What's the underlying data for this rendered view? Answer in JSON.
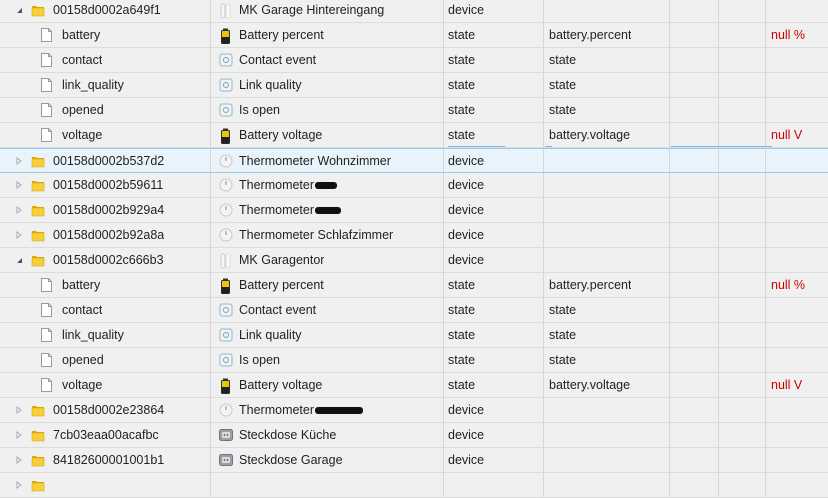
{
  "rows": [
    {
      "kind": "device",
      "expanded": true,
      "id": "00158d0002a649f1",
      "icon": "door-sensor-icon",
      "label": "MK Garage Hintereingang",
      "type": "device",
      "role": "",
      "unit": ""
    },
    {
      "kind": "state",
      "id": "battery",
      "icon": "battery-icon",
      "label": "Battery percent",
      "type": "state",
      "role": "battery.percent",
      "unit": "null %"
    },
    {
      "kind": "state",
      "id": "contact",
      "icon": "state-icon",
      "label": "Contact event",
      "type": "state",
      "role": "state",
      "unit": ""
    },
    {
      "kind": "state",
      "id": "link_quality",
      "icon": "state-icon",
      "label": "Link quality",
      "type": "state",
      "role": "state",
      "unit": ""
    },
    {
      "kind": "state",
      "id": "opened",
      "icon": "state-icon",
      "label": "Is open",
      "type": "state",
      "role": "state",
      "unit": ""
    },
    {
      "kind": "state",
      "id": "voltage",
      "icon": "battery-icon",
      "label": "Battery voltage",
      "type": "state",
      "role": "battery.voltage",
      "unit": "null V"
    },
    {
      "kind": "device",
      "expanded": false,
      "selected": true,
      "id": "00158d0002b537d2",
      "icon": "thermometer-icon",
      "label": "Thermometer Wohnzimmer",
      "type": "device",
      "role": "",
      "unit": ""
    },
    {
      "kind": "device",
      "expanded": false,
      "id": "00158d0002b59611",
      "icon": "thermometer-icon",
      "label": "Thermometer",
      "redacted": true,
      "redactWidth": 22,
      "type": "device",
      "role": "",
      "unit": ""
    },
    {
      "kind": "device",
      "expanded": false,
      "id": "00158d0002b929a4",
      "icon": "thermometer-icon",
      "label": "Thermometer",
      "redacted": true,
      "redactWidth": 26,
      "type": "device",
      "role": "",
      "unit": ""
    },
    {
      "kind": "device",
      "expanded": false,
      "id": "00158d0002b92a8a",
      "icon": "thermometer-icon",
      "label": "Thermometer Schlafzimmer",
      "type": "device",
      "role": "",
      "unit": ""
    },
    {
      "kind": "device",
      "expanded": true,
      "id": "00158d0002c666b3",
      "icon": "door-sensor-icon",
      "label": "MK Garagentor",
      "type": "device",
      "role": "",
      "unit": ""
    },
    {
      "kind": "state",
      "id": "battery",
      "icon": "battery-icon",
      "label": "Battery percent",
      "type": "state",
      "role": "battery.percent",
      "unit": "null %"
    },
    {
      "kind": "state",
      "id": "contact",
      "icon": "state-icon",
      "label": "Contact event",
      "type": "state",
      "role": "state",
      "unit": ""
    },
    {
      "kind": "state",
      "id": "link_quality",
      "icon": "state-icon",
      "label": "Link quality",
      "type": "state",
      "role": "state",
      "unit": ""
    },
    {
      "kind": "state",
      "id": "opened",
      "icon": "state-icon",
      "label": "Is open",
      "type": "state",
      "role": "state",
      "unit": ""
    },
    {
      "kind": "state",
      "id": "voltage",
      "icon": "battery-icon",
      "label": "Battery voltage",
      "type": "state",
      "role": "battery.voltage",
      "unit": "null V"
    },
    {
      "kind": "device",
      "expanded": false,
      "id": "00158d0002e23864",
      "icon": "thermometer-icon",
      "label": "Thermometer",
      "redacted": true,
      "redactWidth": 48,
      "type": "device",
      "role": "",
      "unit": ""
    },
    {
      "kind": "device",
      "expanded": false,
      "id": "7cb03eaa00acafbc",
      "icon": "plug-icon",
      "label": "Steckdose Küche",
      "type": "device",
      "role": "",
      "unit": ""
    },
    {
      "kind": "device",
      "expanded": false,
      "id": "84182600001001b1",
      "icon": "plug-icon",
      "label": "Steckdose Garage",
      "type": "device",
      "role": "",
      "unit": ""
    },
    {
      "kind": "device",
      "expanded": false,
      "partial": true,
      "id": "",
      "icon": "",
      "label": "",
      "type": "",
      "role": "",
      "unit": ""
    }
  ],
  "colors": {
    "unit_red": "#d00000",
    "folder_yellow": "#f3c21b",
    "selected_bg": "#e8f3fb"
  }
}
